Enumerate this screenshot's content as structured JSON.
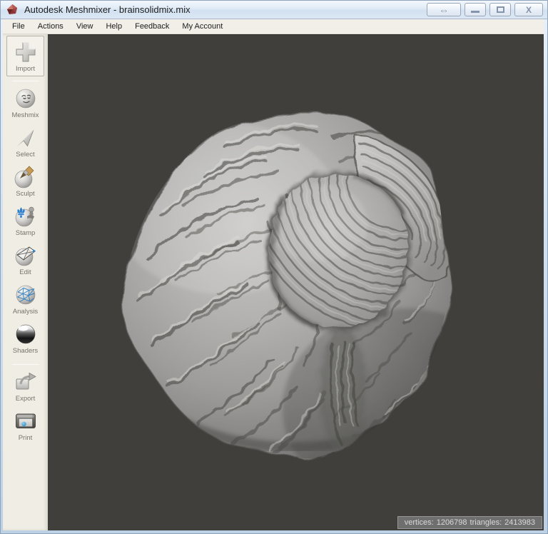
{
  "window": {
    "title": "Autodesk Meshmixer - brainsolidmix.mix",
    "controls": {
      "resize": "horizontal-resize",
      "minimize": "minimize",
      "maximize": "maximize",
      "close": "close"
    },
    "resize_glyph": "⇔",
    "close_glyph": "X"
  },
  "menu": {
    "items": [
      {
        "label": "File"
      },
      {
        "label": "Actions"
      },
      {
        "label": "View"
      },
      {
        "label": "Help"
      },
      {
        "label": "Feedback"
      },
      {
        "label": "My Account"
      }
    ]
  },
  "sidebar": {
    "items": [
      {
        "label": "Import",
        "icon": "plus-icon"
      },
      {
        "label": "Meshmix",
        "icon": "face-sphere-icon"
      },
      {
        "label": "Select",
        "icon": "cursor-arrow-icon"
      },
      {
        "label": "Sculpt",
        "icon": "brush-sphere-icon"
      },
      {
        "label": "Stamp",
        "icon": "fleur-de-lis-sphere-icon"
      },
      {
        "label": "Edit",
        "icon": "plane-sphere-icon"
      },
      {
        "label": "Analysis",
        "icon": "mesh-sphere-icon"
      },
      {
        "label": "Shaders",
        "icon": "chrome-sphere-icon"
      },
      {
        "label": "Export",
        "icon": "export-arrow-icon"
      },
      {
        "label": "Print",
        "icon": "printer-icon"
      }
    ]
  },
  "viewport": {
    "status": {
      "vertices_label": "vertices:",
      "vertices": "1206798",
      "triangles_label": "triangles:",
      "triangles": "2413983"
    }
  },
  "colors": {
    "viewport_bg": "#413f3c",
    "sidebar_bg": "#f0ede4",
    "menu_bg": "#f2efe8",
    "titlebar_bg": "#dbe7f4",
    "status_bg": "#6f6f6f",
    "logo_red": "#8e3434",
    "stamp_blue": "#2a7fd0",
    "analysis_blue": "#2f7fc0",
    "print_blue": "#3aa0d8"
  }
}
